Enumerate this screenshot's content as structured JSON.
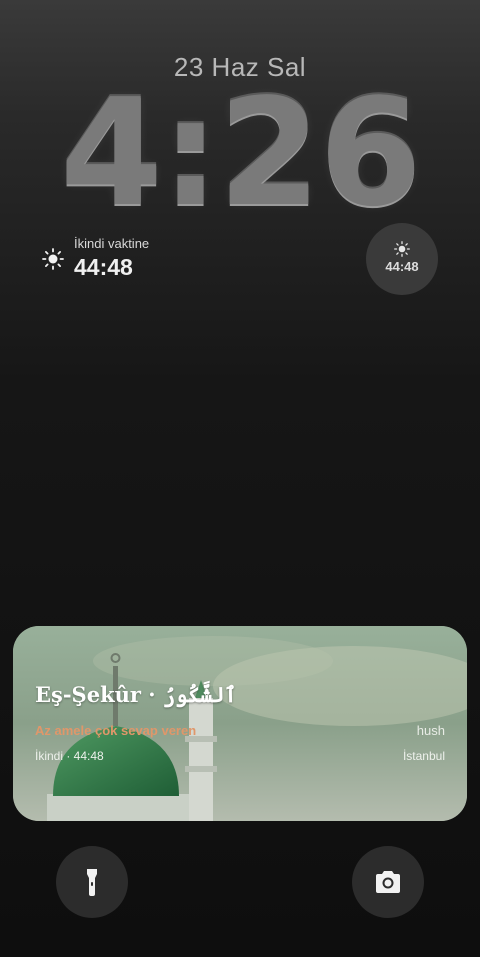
{
  "lockscreen": {
    "date": "23 Haz Sal",
    "time": "4:26"
  },
  "widgets": {
    "left": {
      "icon": "sun-icon",
      "title": "İkindi vaktine",
      "value": "44:48"
    },
    "circle": {
      "icon": "sun-icon",
      "value": "44:48"
    }
  },
  "card": {
    "esma": "Eş-Şekûr · ٱلشَّكُورُ",
    "meaning": "Az amele çok sevap veren",
    "brand": "hush",
    "prayer": "İkindi · 44:48",
    "city": "İstanbul"
  },
  "buttons": {
    "left": "flashlight-icon",
    "right": "camera-icon"
  },
  "colors": {
    "accent_meaning": "#e0976a",
    "card_tint": "#8fa58c"
  }
}
